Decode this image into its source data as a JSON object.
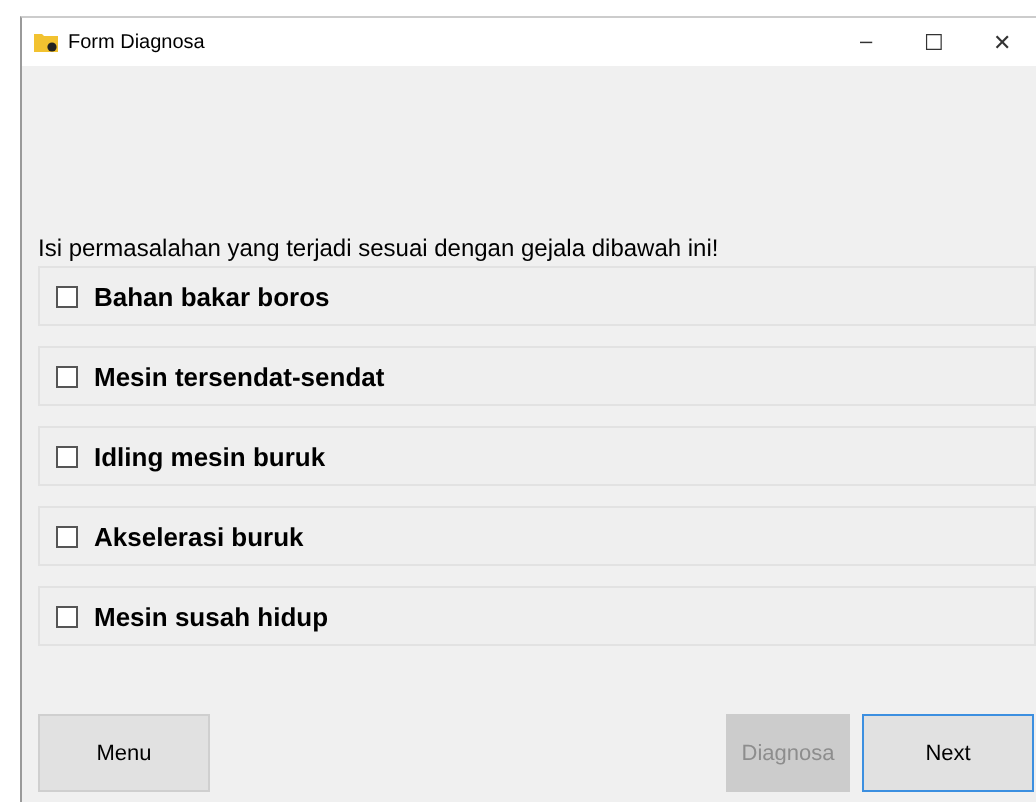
{
  "window": {
    "title": "Form Diagnosa",
    "controls": [
      "–",
      "☐",
      "✕"
    ]
  },
  "instruction": "Isi permasalahan yang terjadi sesuai dengan gejala dibawah ini!",
  "symptoms": [
    {
      "label": "Bahan bakar boros",
      "checked": false
    },
    {
      "label": "Mesin tersendat-sendat",
      "checked": false
    },
    {
      "label": "Idling mesin buruk",
      "checked": false
    },
    {
      "label": "Akselerasi buruk",
      "checked": false
    },
    {
      "label": "Mesin susah hidup",
      "checked": false
    }
  ],
  "buttons": [
    {
      "label": "Menu",
      "disabled": false,
      "focused": false
    },
    {
      "label": "Diagnosa",
      "disabled": true,
      "focused": false
    },
    {
      "label": "Next",
      "disabled": false,
      "focused": true
    }
  ]
}
